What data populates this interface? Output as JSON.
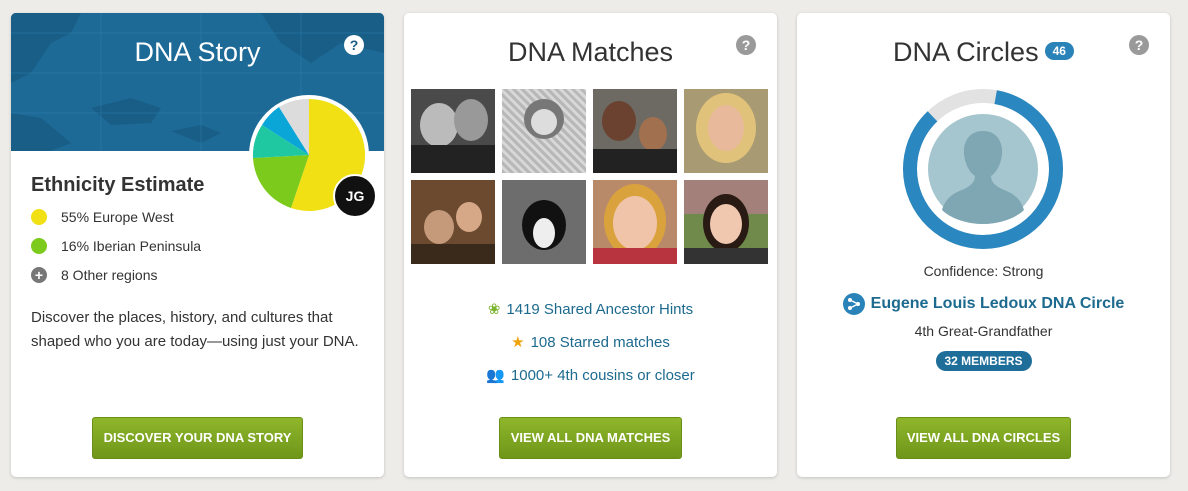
{
  "story": {
    "title": "DNA Story",
    "help_icon": "?",
    "ethnicity_title": "Ethnicity Estimate",
    "regions": [
      {
        "label": "55% Europe West",
        "color": "#f0e014",
        "percent": 55
      },
      {
        "label": "16% Iberian Peninsula",
        "color": "#7ccb1c",
        "percent": 16
      },
      {
        "label": "8 Other regions",
        "icon": "plus-icon"
      }
    ],
    "initials": "JG",
    "description": "Discover the places, history, and cultures that shaped who you are today—using just your DNA.",
    "button": "DISCOVER YOUR DNA STORY"
  },
  "matches": {
    "title": "DNA Matches",
    "help_icon": "?",
    "stats": [
      {
        "label": "1419 Shared Ancestor Hints",
        "icon": "leaf-icon"
      },
      {
        "label": "108 Starred matches",
        "icon": "star-icon"
      },
      {
        "label": "1000+ 4th cousins or closer",
        "icon": "people-icon"
      }
    ],
    "button": "VIEW ALL DNA MATCHES"
  },
  "circles": {
    "title": "DNA Circles",
    "count_badge": "46",
    "help_icon": "?",
    "confidence": "Confidence: Strong",
    "circle_name": "Eugene Louis Ledoux DNA Circle",
    "relation": "4th Great-Grandfather",
    "members": "32 MEMBERS",
    "button": "VIEW ALL DNA CIRCLES"
  },
  "colors": {
    "accent_blue": "#1d6a8f",
    "button_green": "#7aa41f",
    "map_blue": "#1e6a97"
  }
}
